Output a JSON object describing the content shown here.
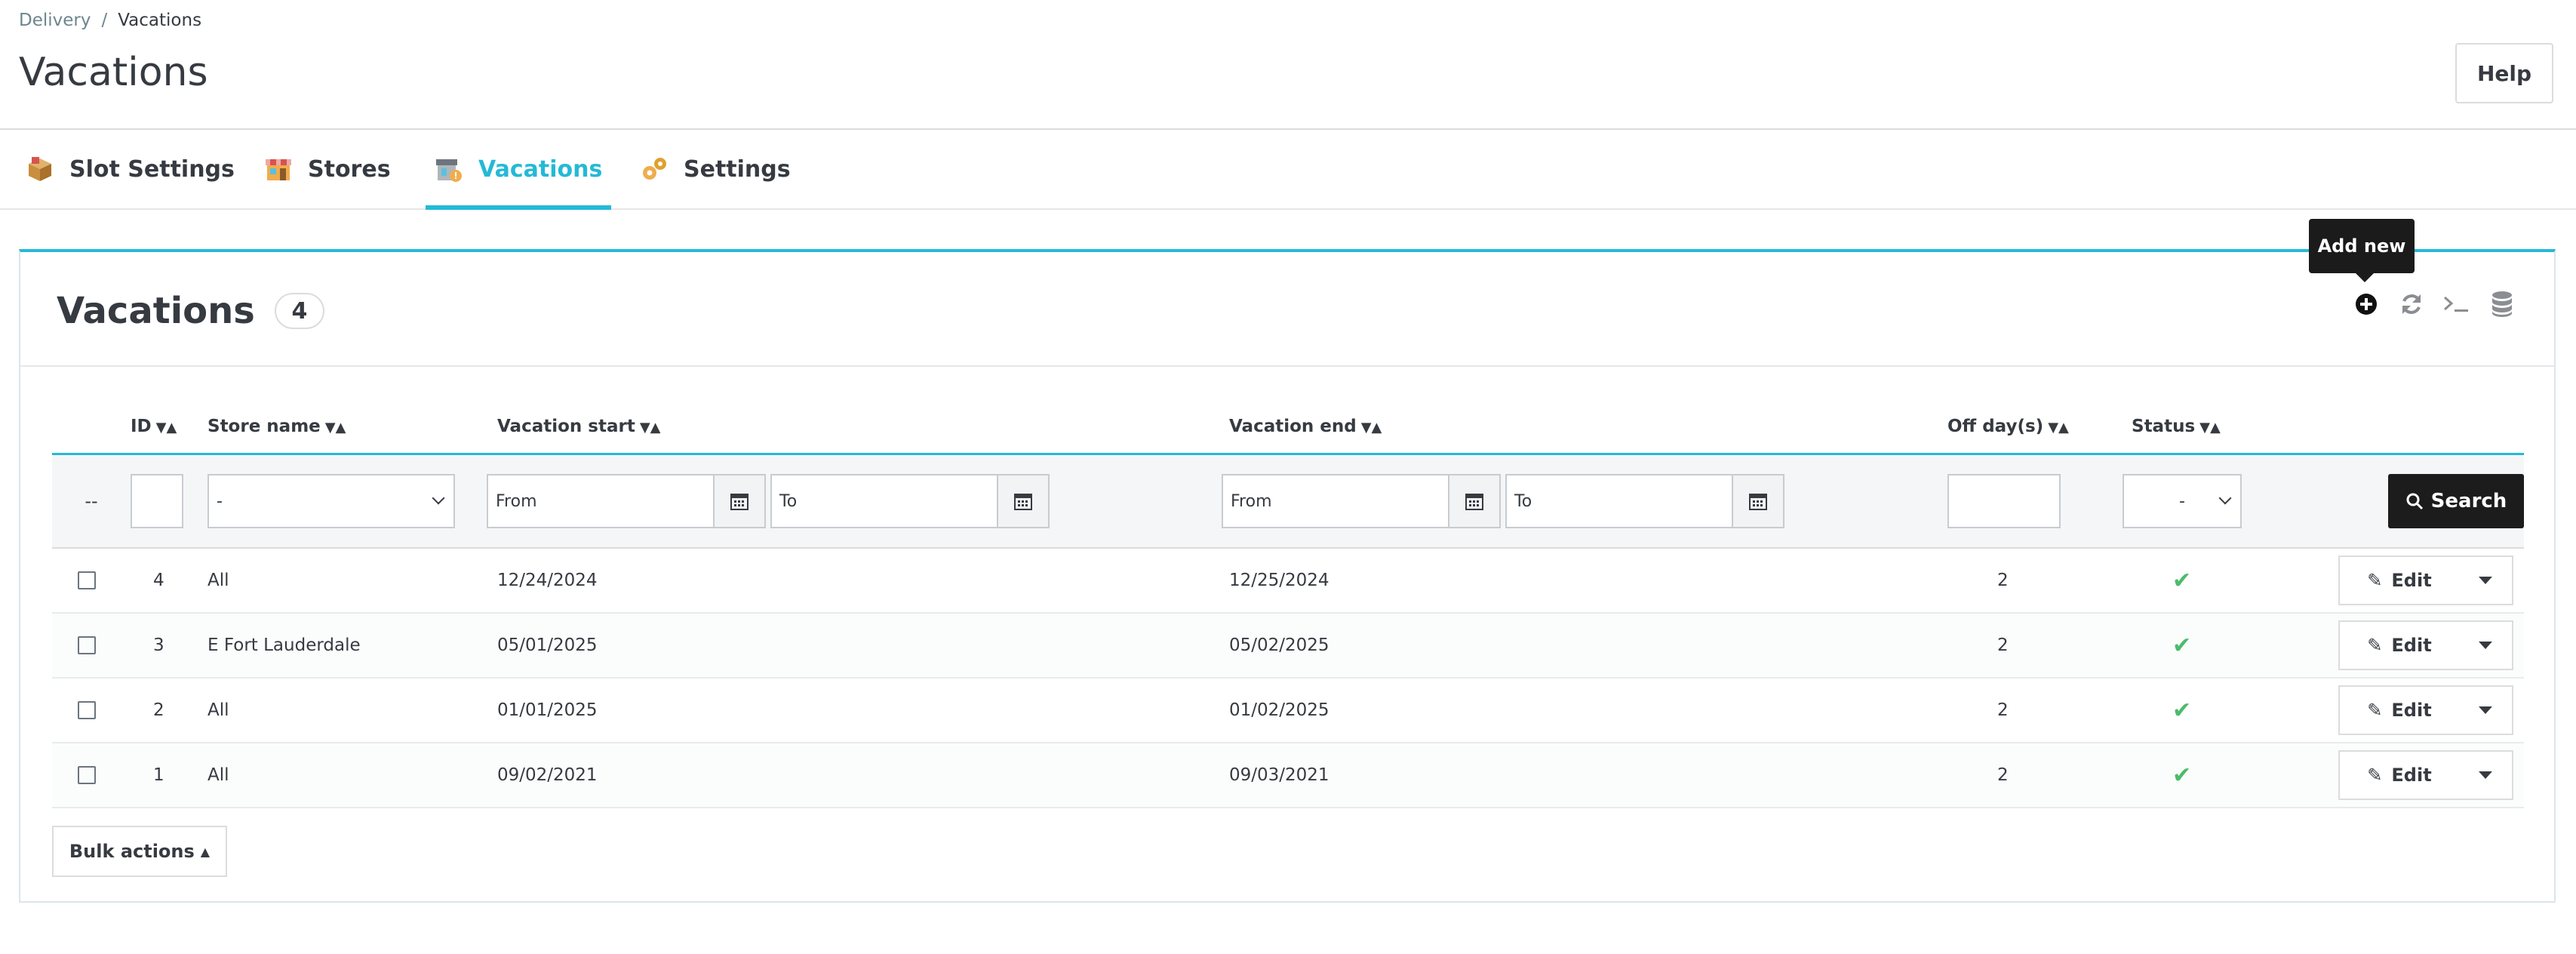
{
  "breadcrumb": {
    "parent": "Delivery",
    "separator": "/",
    "current": "Vacations"
  },
  "page_title": "Vacations",
  "help_label": "Help",
  "tabs": [
    {
      "label": "Slot Settings",
      "icon": "box-icon"
    },
    {
      "label": "Stores",
      "icon": "store-icon"
    },
    {
      "label": "Vacations",
      "icon": "vacation-icon",
      "active": true
    },
    {
      "label": "Settings",
      "icon": "gears-icon"
    }
  ],
  "panel": {
    "title": "Vacations",
    "count": "4",
    "tooltip": "Add new",
    "tools": [
      "add-circle-icon",
      "refresh-icon",
      "terminal-icon",
      "database-icon"
    ]
  },
  "columns": {
    "id": "ID",
    "store_name": "Store name",
    "vacation_start": "Vacation start",
    "vacation_end": "Vacation end",
    "off_days": "Off day(s)",
    "status": "Status"
  },
  "filters": {
    "dash": "--",
    "store_select": "-",
    "start_from": "From",
    "start_to": "To",
    "end_from": "From",
    "end_to": "To",
    "status_select": "-",
    "search_label": "Search"
  },
  "rows": [
    {
      "id": "4",
      "store": "All",
      "start": "12/24/2024",
      "end": "12/25/2024",
      "off_days": "2",
      "edit": "Edit"
    },
    {
      "id": "3",
      "store": "E Fort Lauderdale",
      "start": "05/01/2025",
      "end": "05/02/2025",
      "off_days": "2",
      "edit": "Edit"
    },
    {
      "id": "2",
      "store": "All",
      "start": "01/01/2025",
      "end": "01/02/2025",
      "off_days": "2",
      "edit": "Edit"
    },
    {
      "id": "1",
      "store": "All",
      "start": "09/02/2021",
      "end": "09/03/2021",
      "off_days": "2",
      "edit": "Edit"
    }
  ],
  "bulk_actions": "Bulk actions",
  "colors": {
    "accent": "#25b9d7",
    "status_ok": "#4cbb6c"
  }
}
